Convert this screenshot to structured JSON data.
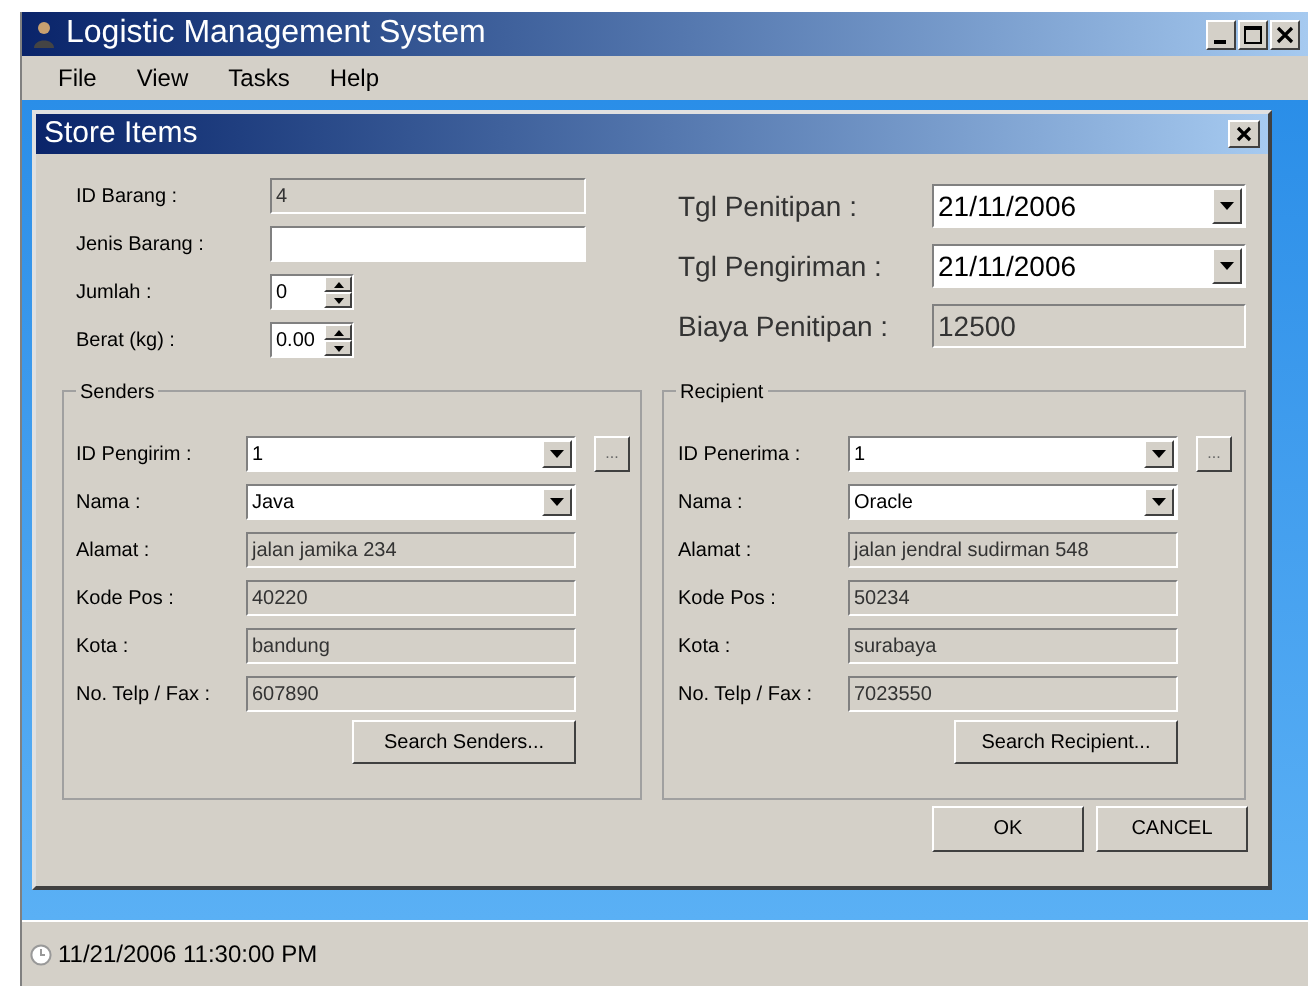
{
  "window": {
    "title": "Logistic Management System"
  },
  "menu": [
    "File",
    "View",
    "Tasks",
    "Help"
  ],
  "dialog": {
    "title": "Store Items",
    "left_fields": [
      {
        "kind": "readonly",
        "label": "ID Barang :",
        "value": "4"
      },
      {
        "kind": "text",
        "label": "Jenis Barang :"
      },
      {
        "kind": "spin",
        "label": "Jumlah :",
        "value": "0"
      },
      {
        "kind": "spin",
        "label": "Berat (kg) :",
        "value": "0.00"
      }
    ],
    "right_fields": [
      {
        "kind": "combo",
        "label": "Tgl Penitipan :",
        "value": "21/11/2006"
      },
      {
        "kind": "combo",
        "label": "Tgl Pengiriman :",
        "value": "21/11/2006"
      },
      {
        "kind": "readonly",
        "label": "Biaya Penitipan :",
        "value": "12500"
      }
    ],
    "groups": [
      {
        "title": "Senders",
        "search_button": "Search Senders...",
        "rows": [
          {
            "kind": "combo",
            "label": "ID Pengirim :",
            "value": "1",
            "browse": "..."
          },
          {
            "kind": "combo",
            "label": "Nama :",
            "value": "Java"
          },
          {
            "kind": "readonly",
            "label": "Alamat :",
            "value": "jalan jamika 234"
          },
          {
            "kind": "readonly",
            "label": "Kode Pos :",
            "value": "40220"
          },
          {
            "kind": "readonly",
            "label": "Kota :",
            "value": "bandung"
          },
          {
            "kind": "readonly",
            "label": "No. Telp / Fax :",
            "value": "607890"
          }
        ]
      },
      {
        "title": "Recipient",
        "search_button": "Search Recipient...",
        "rows": [
          {
            "kind": "combo",
            "label": "ID Penerima :",
            "value": "1",
            "browse": "..."
          },
          {
            "kind": "combo",
            "label": "Nama :",
            "value": "Oracle"
          },
          {
            "kind": "readonly",
            "label": "Alamat :",
            "value": "jalan jendral sudirman 548"
          },
          {
            "kind": "readonly",
            "label": "Kode Pos :",
            "value": "50234"
          },
          {
            "kind": "readonly",
            "label": "Kota :",
            "value": "surabaya"
          },
          {
            "kind": "readonly",
            "label": "No. Telp / Fax :",
            "value": "7023550"
          }
        ]
      }
    ],
    "buttons": [
      "OK",
      "CANCEL"
    ]
  },
  "status_bar": {
    "datetime": "11/21/2006 11:30:00 PM"
  }
}
